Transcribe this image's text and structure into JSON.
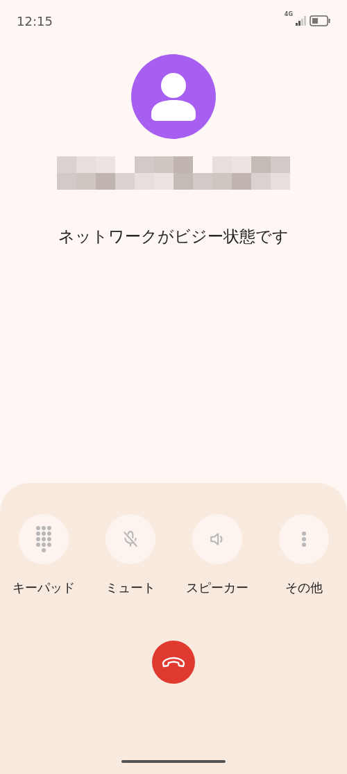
{
  "status_bar": {
    "time": "12:15",
    "network": "4G"
  },
  "call": {
    "status": "ネットワークがビジー状態です"
  },
  "actions": [
    {
      "kind": "keypad",
      "label": "キーパッド"
    },
    {
      "kind": "mute",
      "label": "ミュート"
    },
    {
      "kind": "speaker",
      "label": "スピーカー"
    },
    {
      "kind": "more",
      "label": "その他"
    }
  ]
}
